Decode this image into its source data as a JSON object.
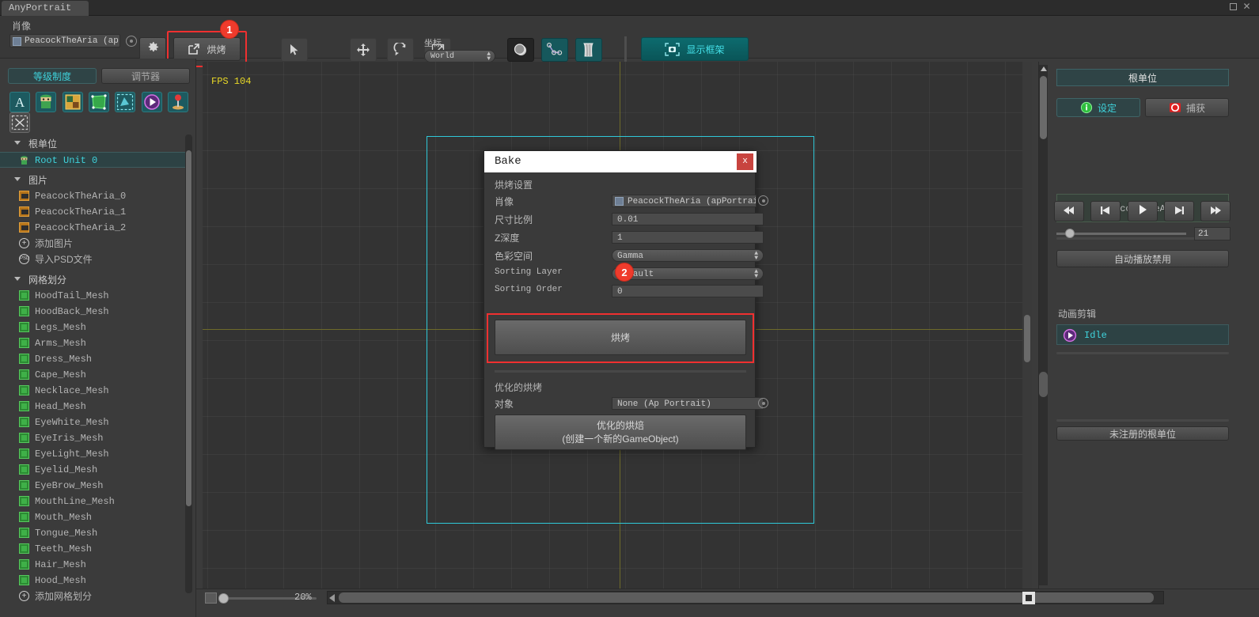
{
  "window": {
    "tab_title": "AnyPortrait",
    "minimize_icon": "restore-icon",
    "close_icon": "close-icon",
    "menu_icon": "hamburger-menu-icon"
  },
  "toolbar": {
    "portrait_label": "肖像",
    "portrait_value": "PeacockTheAria (ap",
    "gear_icon": "gear-icon",
    "bake_label": "烘烤",
    "bake_icon": "export-icon",
    "tools": [
      {
        "name": "select-tool",
        "icon": "cursor-arrow-icon"
      },
      {
        "name": "move-tool",
        "icon": "move-cross-icon"
      },
      {
        "name": "rotate-tool",
        "icon": "rotate-icon"
      },
      {
        "name": "scale-tool",
        "icon": "scale-icon"
      }
    ],
    "coord_label": "坐标",
    "coord_value": "World",
    "texture_icon": "texture-sphere-icon",
    "bone_icon": "bone-rig-icon",
    "physics_icon": "cloth-physics-icon",
    "show_frame_label": "显示框架",
    "show_frame_icon": "camera-frame-icon"
  },
  "callouts": [
    {
      "id": "1",
      "label": "1"
    },
    {
      "id": "2",
      "label": "2"
    }
  ],
  "left_panel": {
    "tabs": [
      {
        "label": "等级制度",
        "active": true
      },
      {
        "label": "调节器",
        "active": false
      }
    ],
    "icon_buttons": [
      "text-tool-icon",
      "character-icon",
      "image-tool-icon",
      "mesh-tool-icon",
      "mesh-group-icon",
      "animation-icon",
      "control-param-icon",
      "deselect-icon"
    ],
    "groups": [
      {
        "title": "根单位",
        "items": [
          {
            "label": "Root Unit 0",
            "icon": "root-unit-icon",
            "selected": true
          }
        ]
      },
      {
        "title": "图片",
        "items": [
          {
            "label": "PeacockTheAria_0",
            "icon": "image-icon",
            "selected": false
          },
          {
            "label": "PeacockTheAria_1",
            "icon": "image-icon",
            "selected": false
          },
          {
            "label": "PeacockTheAria_2",
            "icon": "image-icon",
            "selected": false
          },
          {
            "label": "添加图片",
            "icon": "plus-circle-icon",
            "selected": false,
            "action": true
          },
          {
            "label": "导入PSD文件",
            "icon": "psd-circle-icon",
            "selected": false,
            "action": true
          }
        ]
      },
      {
        "title": "网格划分",
        "items": [
          {
            "label": "HoodTail_Mesh",
            "icon": "mesh-icon",
            "selected": false
          },
          {
            "label": "HoodBack_Mesh",
            "icon": "mesh-icon",
            "selected": false
          },
          {
            "label": "Legs_Mesh",
            "icon": "mesh-icon",
            "selected": false
          },
          {
            "label": "Arms_Mesh",
            "icon": "mesh-icon",
            "selected": false
          },
          {
            "label": "Dress_Mesh",
            "icon": "mesh-icon",
            "selected": false
          },
          {
            "label": "Cape_Mesh",
            "icon": "mesh-icon",
            "selected": false
          },
          {
            "label": "Necklace_Mesh",
            "icon": "mesh-icon",
            "selected": false
          },
          {
            "label": "Head_Mesh",
            "icon": "mesh-icon",
            "selected": false
          },
          {
            "label": "EyeWhite_Mesh",
            "icon": "mesh-icon",
            "selected": false
          },
          {
            "label": "EyeIris_Mesh",
            "icon": "mesh-icon",
            "selected": false
          },
          {
            "label": "EyeLight_Mesh",
            "icon": "mesh-icon",
            "selected": false
          },
          {
            "label": "Eyelid_Mesh",
            "icon": "mesh-icon",
            "selected": false
          },
          {
            "label": "EyeBrow_Mesh",
            "icon": "mesh-icon",
            "selected": false
          },
          {
            "label": "MouthLine_Mesh",
            "icon": "mesh-icon",
            "selected": false
          },
          {
            "label": "Mouth_Mesh",
            "icon": "mesh-icon",
            "selected": false
          },
          {
            "label": "Tongue_Mesh",
            "icon": "mesh-icon",
            "selected": false
          },
          {
            "label": "Teeth_Mesh",
            "icon": "mesh-icon",
            "selected": false
          },
          {
            "label": "Hair_Mesh",
            "icon": "mesh-icon",
            "selected": false
          },
          {
            "label": "Hood_Mesh",
            "icon": "mesh-icon",
            "selected": false
          },
          {
            "label": "添加网格划分",
            "icon": "plus-circle-icon",
            "selected": false,
            "action": true
          }
        ]
      }
    ]
  },
  "canvas": {
    "fps_text": "FPS 104",
    "bounds_color": "#2fc8d8",
    "axis_color": "#6e6a2a"
  },
  "bottom_bar": {
    "fit_icon": "fit-to-view-icon",
    "zoom_percent": "20%"
  },
  "right_panel": {
    "title": "根单位",
    "tabs": [
      {
        "label": "设定",
        "icon": "info-icon",
        "active": true
      },
      {
        "label": "捕获",
        "icon": "record-icon",
        "active": false
      }
    ],
    "name_box": "[PeacockTheAria]",
    "transport": [
      {
        "name": "skip-to-start-button",
        "icon": "⏮"
      },
      {
        "name": "prev-frame-button",
        "icon": "◀|"
      },
      {
        "name": "play-button",
        "icon": "▶"
      },
      {
        "name": "next-frame-button",
        "icon": "|▶"
      },
      {
        "name": "skip-to-end-button",
        "icon": "⏭"
      }
    ],
    "frame_value": "21",
    "autoplay_label": "自动播放禁用",
    "clips_label": "动画剪辑",
    "clips": [
      {
        "label": "Idle",
        "icon": "animation-clip-icon",
        "selected": true
      }
    ],
    "unregistered_label": "未注册的根单位"
  },
  "bake_dialog": {
    "title": "Bake",
    "close_label": "x",
    "settings_label": "烘烤设置",
    "fields": [
      {
        "label": "肖像",
        "value": "PeacockTheAria (apPortrait",
        "type": "objectref"
      },
      {
        "label": "尺寸比例",
        "value": "0.01",
        "type": "text"
      },
      {
        "label": "Z深度",
        "value": "1",
        "type": "text"
      },
      {
        "label": "色彩空间",
        "value": "Gamma",
        "type": "dropdown"
      },
      {
        "label": "Sorting Layer",
        "value": "Default",
        "type": "dropdown"
      },
      {
        "label": "Sorting Order",
        "value": "0",
        "type": "text"
      }
    ],
    "bake_action_label": "烘烤",
    "optimized_label": "优化的烘烤",
    "target_label": "对象",
    "target_value": "None (Ap Portrait)",
    "optimized_button_line1": "优化的烘焙",
    "optimized_button_line2": "(创建一个新的GameObject)"
  }
}
